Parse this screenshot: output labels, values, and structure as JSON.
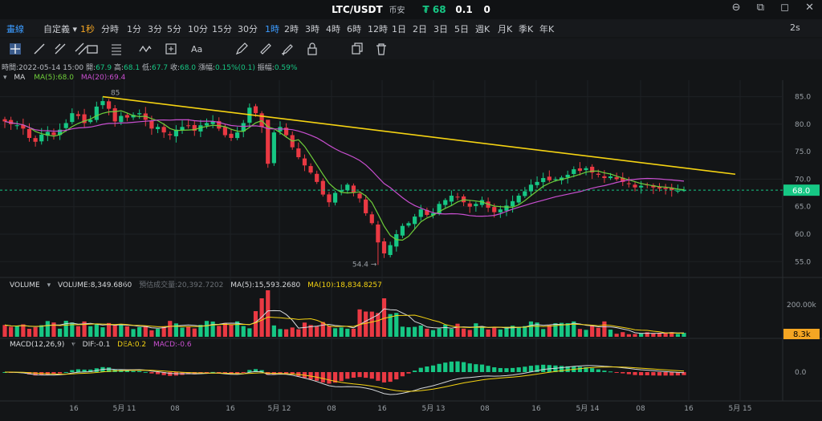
{
  "title": {
    "pair": "LTC/USDT",
    "market": "币安",
    "price": "₮ 68",
    "change": "0.1",
    "zero": "0"
  },
  "window": {
    "restore": "⊖",
    "tile": "⧉",
    "max": "◻",
    "close": "✕"
  },
  "timeframes": [
    {
      "label": "畫線",
      "sel": true
    },
    {
      "label": "自定義 ▾"
    },
    {
      "label": "1秒",
      "highlight": true
    },
    {
      "label": "分時"
    },
    {
      "label": "1分"
    },
    {
      "label": "3分"
    },
    {
      "label": "5分"
    },
    {
      "label": "10分"
    },
    {
      "label": "15分"
    },
    {
      "label": "30分"
    },
    {
      "label": "1時",
      "sel": true
    },
    {
      "label": "2時"
    },
    {
      "label": "3時"
    },
    {
      "label": "4時"
    },
    {
      "label": "6時"
    },
    {
      "label": "12時"
    },
    {
      "label": "1日"
    },
    {
      "label": "2日"
    },
    {
      "label": "3日"
    },
    {
      "label": "5日"
    },
    {
      "label": "週K"
    },
    {
      "label": "月K"
    },
    {
      "label": "季K"
    },
    {
      "label": "年K"
    }
  ],
  "speed": "2s",
  "tools": [
    "crosshair-icon",
    "line-icon",
    "ray-icon",
    "parallel-icon",
    "rect-icon",
    "fib-icon",
    "wave-icon",
    "measure-icon",
    "text-icon",
    "pencil-icon",
    "ruler-icon",
    "brush-icon",
    "lock-icon",
    "copy-icon",
    "delete-icon"
  ],
  "ohlc_info": {
    "time_label": "時間:",
    "time": "2022-05-14 15:00",
    "open_label": "開:",
    "open": "67.9",
    "high_label": "高:",
    "high": "68.1",
    "low_label": "低:",
    "low": "67.7",
    "close_label": "收:",
    "close": "68.0",
    "chg_label": "漲幅:",
    "chg": "0.15%(0.1)",
    "amp_label": "振幅:",
    "amp": "0.59%"
  },
  "ma_legend": {
    "name": "MA",
    "ma5": "MA(5):68.0",
    "ma20": "MA(20):69.4"
  },
  "vol_legend": {
    "name": "VOLUME",
    "vol": "VOLUME:8,349.6860",
    "est": "預估成交量:20,392.7202",
    "ma5": "MA(5):15,593.2680",
    "ma10": "MA(10):18,834.8257"
  },
  "macd_legend": {
    "name": "MACD(12,26,9)",
    "dif": "DIF:-0.1",
    "dea": "DEA:0.2",
    "macd": "MACD:-0.6"
  },
  "colors": {
    "up": "#16c784",
    "down": "#ea3943",
    "ma5": "#6fcf3a",
    "ma20": "#c94fd0",
    "trend": "#f5d312",
    "price_tag": "#16c784",
    "vol_tag": "#f5a623"
  },
  "chart_data": {
    "type": "candlestick",
    "timeframe": "1時",
    "y_ticks": [
      "85.0",
      "80.0",
      "75.0",
      "70.0",
      "65.0",
      "60.0",
      "55.0"
    ],
    "ylim": [
      53,
      88
    ],
    "last_price": "68.0",
    "high_label": "85",
    "low_label": "54.4",
    "x_ticks": [
      "16",
      "5月 11",
      "08",
      "16",
      "5月 12",
      "08",
      "16",
      "5月 13",
      "08",
      "16",
      "5月 14",
      "08",
      "16",
      "5月 15"
    ],
    "vol_axis": {
      "ticks": [
        "200.00k"
      ],
      "last": "8.3k",
      "max": 300000
    },
    "macd_axis": {
      "ticks": [
        "0.0"
      ]
    },
    "closes": [
      80.5,
      80.0,
      79.8,
      79.2,
      77.5,
      76.8,
      78.1,
      78.6,
      78.0,
      79.0,
      80.2,
      82.0,
      81.5,
      80.2,
      80.8,
      83.2,
      84.2,
      82.8,
      80.5,
      81.5,
      81.2,
      81.7,
      82.0,
      80.8,
      79.2,
      79.5,
      78.5,
      78.0,
      79.0,
      79.5,
      79.7,
      78.8,
      79.8,
      80.2,
      80.5,
      79.2,
      78.0,
      77.5,
      78.5,
      80.2,
      83.0,
      82.0,
      79.5,
      72.8,
      78.5,
      79.5,
      78.0,
      75.8,
      74.0,
      72.5,
      71.2,
      69.5,
      67.2,
      65.8,
      67.5,
      68.0,
      69.0,
      67.5,
      66.5,
      63.8,
      62.0,
      58.5,
      56.5,
      58.0,
      60.0,
      61.5,
      62.0,
      63.2,
      64.5,
      63.5,
      63.8,
      65.5,
      66.2,
      67.0,
      66.8,
      65.8,
      65.0,
      65.5,
      66.2,
      64.8,
      64.0,
      64.5,
      65.2,
      66.0,
      67.0,
      67.8,
      69.0,
      69.5,
      70.2,
      69.8,
      70.0,
      70.3,
      70.8,
      71.8,
      71.5,
      72.0,
      71.2,
      70.8,
      70.2,
      70.5,
      70.0,
      69.5,
      69.2,
      68.5,
      68.8,
      69.0,
      68.5,
      68.3,
      68.2,
      68.0,
      67.9,
      68.0
    ],
    "highs_adj": [
      1.0
    ],
    "ma5_end": 68.0,
    "ma20_end": 69.4
  }
}
